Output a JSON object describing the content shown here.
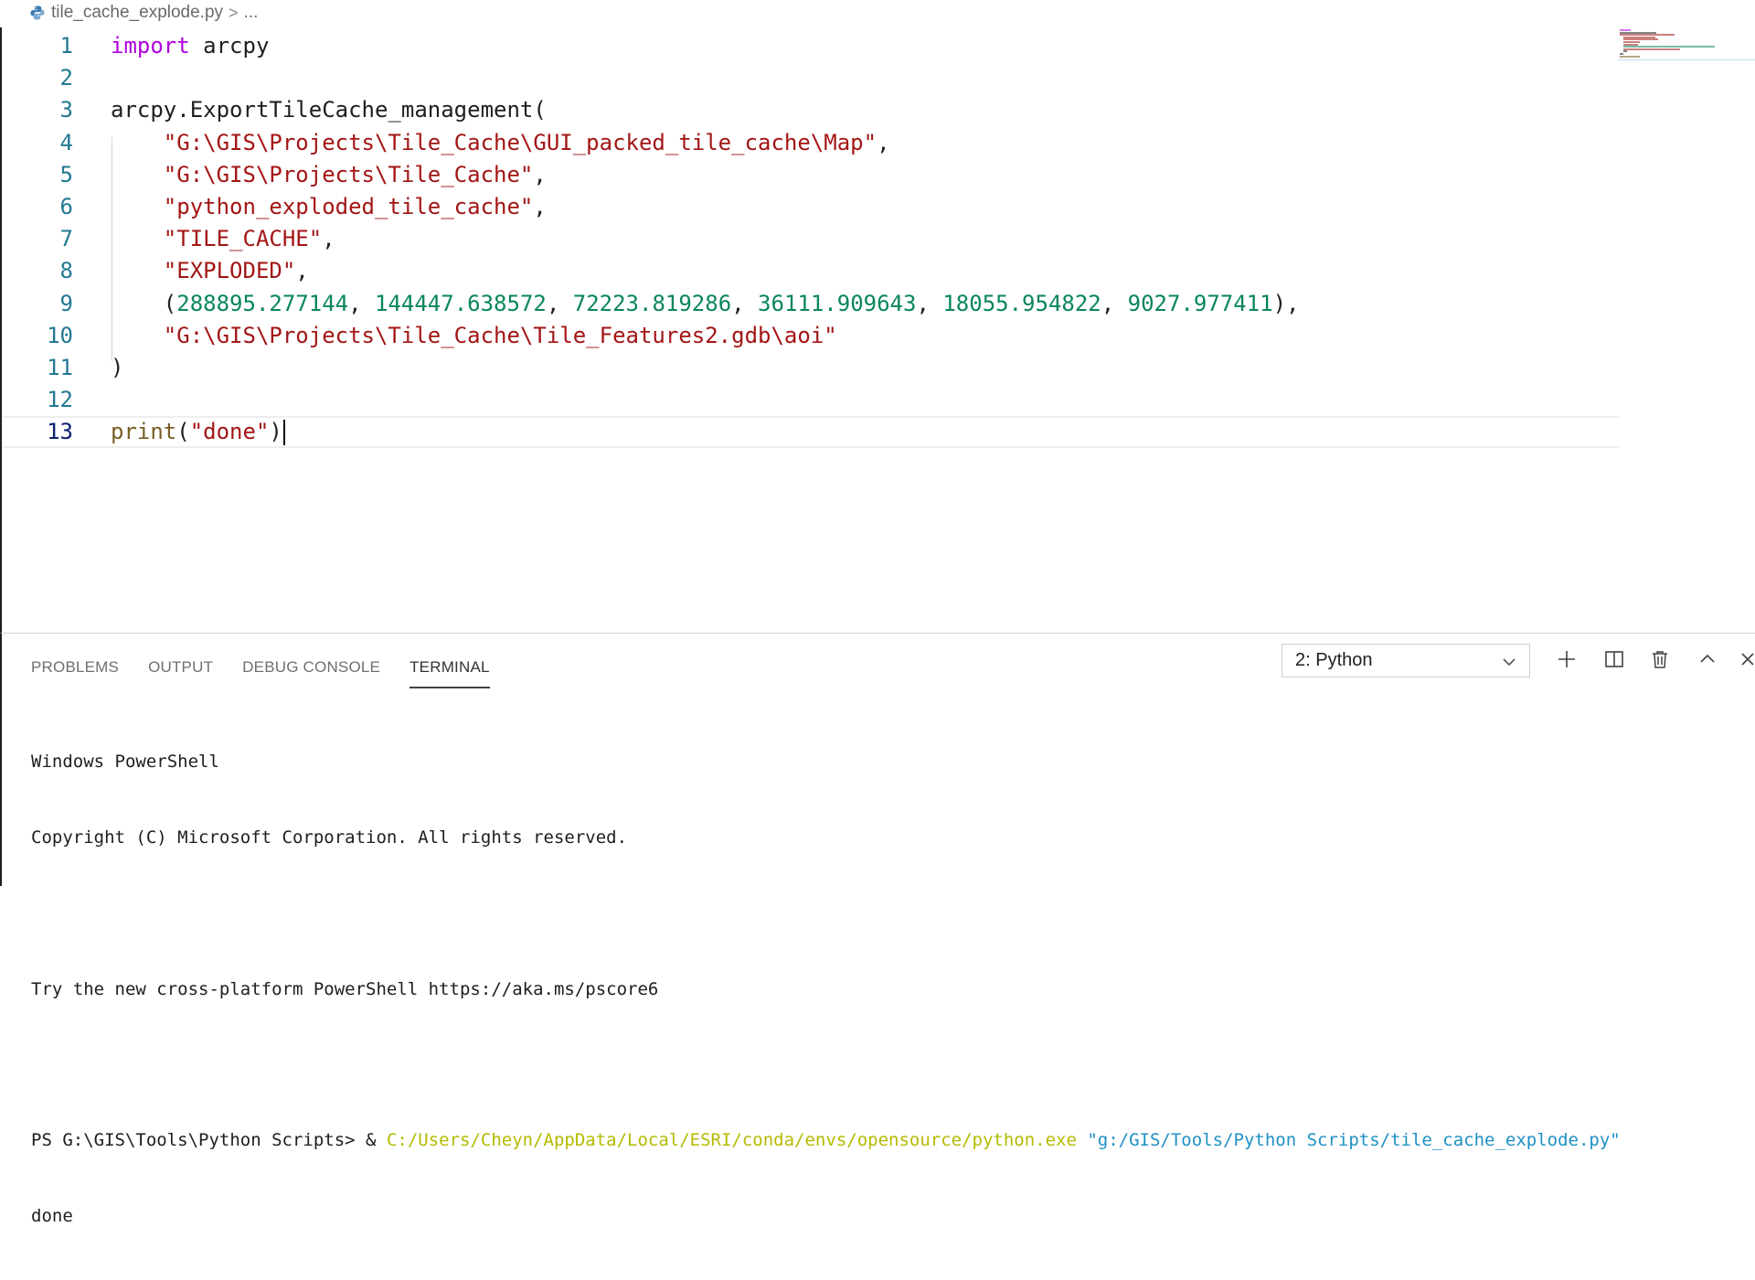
{
  "breadcrumb": {
    "file": "tile_cache_explode.py",
    "separator": ">",
    "ellipsis": "..."
  },
  "editor": {
    "lines": [
      {
        "num": "1",
        "tokens": [
          {
            "t": "kw",
            "v": "import"
          },
          {
            "t": "plain",
            "v": " arcpy"
          }
        ]
      },
      {
        "num": "2",
        "tokens": []
      },
      {
        "num": "3",
        "tokens": [
          {
            "t": "plain",
            "v": "arcpy.ExportTileCache_management("
          }
        ]
      },
      {
        "num": "4",
        "tokens": [
          {
            "t": "plain",
            "v": "    "
          },
          {
            "t": "str",
            "v": "\"G:\\GIS\\Projects\\Tile_Cache\\GUI_packed_tile_cache\\Map\""
          },
          {
            "t": "plain",
            "v": ","
          }
        ]
      },
      {
        "num": "5",
        "tokens": [
          {
            "t": "plain",
            "v": "    "
          },
          {
            "t": "str",
            "v": "\"G:\\GIS\\Projects\\Tile_Cache\""
          },
          {
            "t": "plain",
            "v": ","
          }
        ]
      },
      {
        "num": "6",
        "tokens": [
          {
            "t": "plain",
            "v": "    "
          },
          {
            "t": "str",
            "v": "\"python_exploded_tile_cache\""
          },
          {
            "t": "plain",
            "v": ","
          }
        ]
      },
      {
        "num": "7",
        "tokens": [
          {
            "t": "plain",
            "v": "    "
          },
          {
            "t": "str",
            "v": "\"TILE_CACHE\""
          },
          {
            "t": "plain",
            "v": ","
          }
        ]
      },
      {
        "num": "8",
        "tokens": [
          {
            "t": "plain",
            "v": "    "
          },
          {
            "t": "str",
            "v": "\"EXPLODED\""
          },
          {
            "t": "plain",
            "v": ","
          }
        ]
      },
      {
        "num": "9",
        "tokens": [
          {
            "t": "plain",
            "v": "    ("
          },
          {
            "t": "num",
            "v": "288895.277144"
          },
          {
            "t": "plain",
            "v": ", "
          },
          {
            "t": "num",
            "v": "144447.638572"
          },
          {
            "t": "plain",
            "v": ", "
          },
          {
            "t": "num",
            "v": "72223.819286"
          },
          {
            "t": "plain",
            "v": ", "
          },
          {
            "t": "num",
            "v": "36111.909643"
          },
          {
            "t": "plain",
            "v": ", "
          },
          {
            "t": "num",
            "v": "18055.954822"
          },
          {
            "t": "plain",
            "v": ", "
          },
          {
            "t": "num",
            "v": "9027.977411"
          },
          {
            "t": "plain",
            "v": "),"
          }
        ]
      },
      {
        "num": "10",
        "tokens": [
          {
            "t": "plain",
            "v": "    "
          },
          {
            "t": "str",
            "v": "\"G:\\GIS\\Projects\\Tile_Cache\\Tile_Features2.gdb\\aoi\""
          }
        ]
      },
      {
        "num": "11",
        "tokens": [
          {
            "t": "plain",
            "v": ")"
          }
        ]
      },
      {
        "num": "12",
        "tokens": []
      },
      {
        "num": "13",
        "tokens": [
          {
            "t": "fn",
            "v": "print"
          },
          {
            "t": "plain",
            "v": "("
          },
          {
            "t": "str",
            "v": "\"done\""
          },
          {
            "t": "plain",
            "v": ")"
          }
        ],
        "current": true
      }
    ]
  },
  "panel": {
    "tabs": [
      {
        "label": "PROBLEMS",
        "name": "tab-problems"
      },
      {
        "label": "OUTPUT",
        "name": "tab-output"
      },
      {
        "label": "DEBUG CONSOLE",
        "name": "tab-debug-console"
      },
      {
        "label": "TERMINAL",
        "name": "tab-terminal",
        "active": true
      }
    ],
    "terminal_select": "2: Python",
    "terminal": {
      "line1": "Windows PowerShell",
      "line2": "Copyright (C) Microsoft Corporation. All rights reserved.",
      "line3": "",
      "line4": "Try the new cross-platform PowerShell https://aka.ms/pscore6",
      "line5": "",
      "prompt": "PS G:\\GIS\\Tools\\Python Scripts> & ",
      "exe": "C:/Users/Cheyn/AppData/Local/ESRI/conda/envs/opensource/python.exe",
      "arg": " \"g:/GIS/Tools/Python Scripts/tile_cache_explode.py\"",
      "output": "done"
    }
  },
  "icons": {
    "file_type": "python-file-icon",
    "new_terminal": "plus-icon",
    "split_terminal": "split-icon",
    "kill_terminal": "trash-icon",
    "maximize_panel": "chevron-up-icon",
    "close_panel": "close-icon"
  },
  "colors": {
    "keyword": "#af00db",
    "function": "#795e26",
    "string": "#a31515",
    "number": "#098658",
    "line_number": "#237893",
    "terminal_exe": "#b5ba00",
    "terminal_arg": "#1e90c4"
  }
}
